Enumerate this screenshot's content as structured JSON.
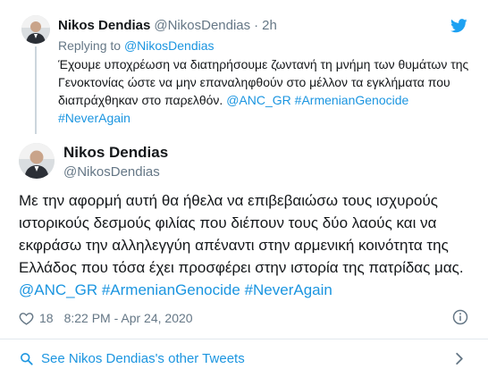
{
  "parent_tweet": {
    "name": "Nikos Dendias",
    "handle": "@NikosDendias",
    "separator": "·",
    "time": "2h",
    "replying_prefix": "Replying to",
    "replying_handle": "@NikosDendias",
    "text": "Έχουμε υποχρέωση να διατηρήσουμε ζωντανή τη μνήμη των θυμάτων της Γενοκτονίας ώστε να μην επαναληφθούν στο μέλλον τα εγκλήματα που διαπράχθηκαν στο παρελθόν.",
    "mention": "@ANC_GR",
    "hashtag_1": "#ArmenianGenocide",
    "hashtag_2": "#NeverAgain"
  },
  "main_tweet": {
    "name": "Nikos Dendias",
    "handle": "@NikosDendias",
    "text": "Με την αφορμή αυτή θα ήθελα να επιβεβαιώσω τους ισχυρούς ιστορικούς δεσμούς φιλίας που διέπουν τους δύο λαούς και να εκφράσω την αλληλεγγύη απέναντι στην αρμενική κοινότητα της Ελλάδος που τόσα έχει προσφέρει στην ιστορία της πατρίδας μας.",
    "mention": "@ANC_GR",
    "hashtag_1": "#ArmenianGenocide",
    "hashtag_2": "#NeverAgain",
    "like_count": "18",
    "timestamp": "8:22 PM - Apr 24, 2020"
  },
  "footer": {
    "other_tweets_label": "See Nikos Dendias's other Tweets"
  },
  "icons": {
    "brand": "twitter-bird-icon",
    "like": "heart-icon",
    "info": "info-icon",
    "search": "search-icon",
    "chevron": "chevron-right-icon"
  },
  "colors": {
    "link": "#1b95e0",
    "muted": "#657786",
    "text": "#14171a",
    "thread_line": "#ccd6dd"
  }
}
